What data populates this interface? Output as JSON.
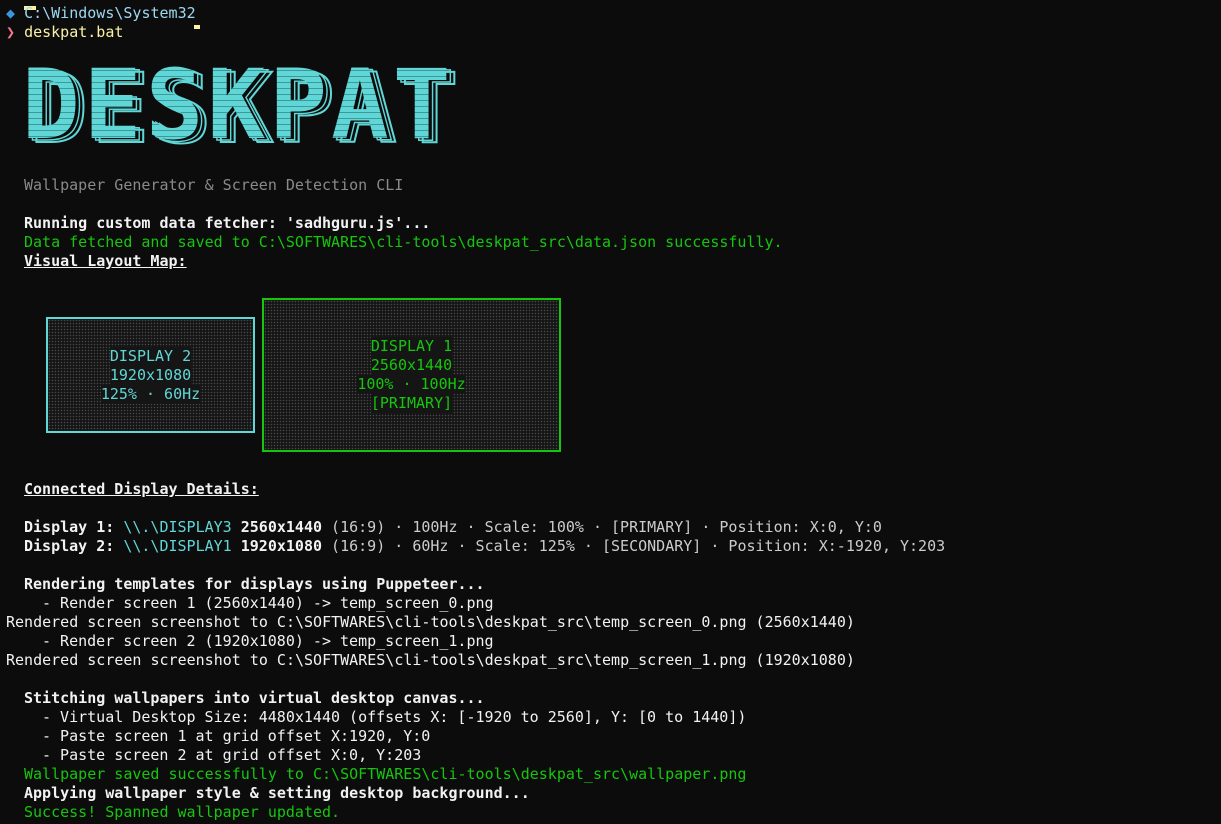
{
  "prompt": {
    "path_icon": "◆",
    "path": "C:\\Windows\\System32",
    "cmd_icon": "❯",
    "command": "deskpat.bat"
  },
  "logo": {
    "text": "DESKPAT",
    "subtitle": "Wallpaper Generator & Screen Detection CLI",
    "color": "#61d6d6"
  },
  "fetch": {
    "running": "Running custom data fetcher: 'sadhguru.js'...",
    "saved": "Data fetched and saved to C:\\SOFTWARES\\cli-tools\\deskpat_src\\data.json successfully."
  },
  "layout_map": {
    "heading": "Visual Layout Map:",
    "display2": {
      "name": "DISPLAY 2",
      "resolution": "1920x1080",
      "rate": "125% · 60Hz"
    },
    "display1": {
      "name": "DISPLAY 1",
      "resolution": "2560x1440",
      "rate": "100% · 100Hz",
      "tag": "[PRIMARY]"
    }
  },
  "details": {
    "heading": "Connected Display Details:",
    "rows": [
      {
        "label": "Display 1: ",
        "device": "\\\\.\\DISPLAY3",
        "res": "2560x1440",
        "rest": " (16:9) · 100Hz · Scale: 100% · [PRIMARY] · Position: X:0, Y:0"
      },
      {
        "label": "Display 2: ",
        "device": "\\\\.\\DISPLAY1",
        "res": "1920x1080",
        "rest": " (16:9) · 60Hz · Scale: 125% · [SECONDARY] · Position: X:-1920, Y:203"
      }
    ]
  },
  "render": {
    "heading": "Rendering templates for displays using Puppeteer...",
    "step1": "- Render screen 1 (2560x1440) -> temp_screen_0.png",
    "done1": "Rendered screen screenshot to C:\\SOFTWARES\\cli-tools\\deskpat_src\\temp_screen_0.png (2560x1440)",
    "step2": "- Render screen 2 (1920x1080) -> temp_screen_1.png",
    "done2": "Rendered screen screenshot to C:\\SOFTWARES\\cli-tools\\deskpat_src\\temp_screen_1.png (1920x1080)"
  },
  "stitch": {
    "heading": "Stitching wallpapers into virtual desktop canvas...",
    "size": "- Virtual Desktop Size: 4480x1440 (offsets X: [-1920 to 2560], Y: [0 to 1440])",
    "paste1": "- Paste screen 1 at grid offset X:1920, Y:0",
    "paste2": "- Paste screen 2 at grid offset X:0, Y:203",
    "saved": "Wallpaper saved successfully to C:\\SOFTWARES\\cli-tools\\deskpat_src\\wallpaper.png",
    "applying": "Applying wallpaper style & setting desktop background...",
    "success": "Success! Spanned wallpaper updated."
  }
}
